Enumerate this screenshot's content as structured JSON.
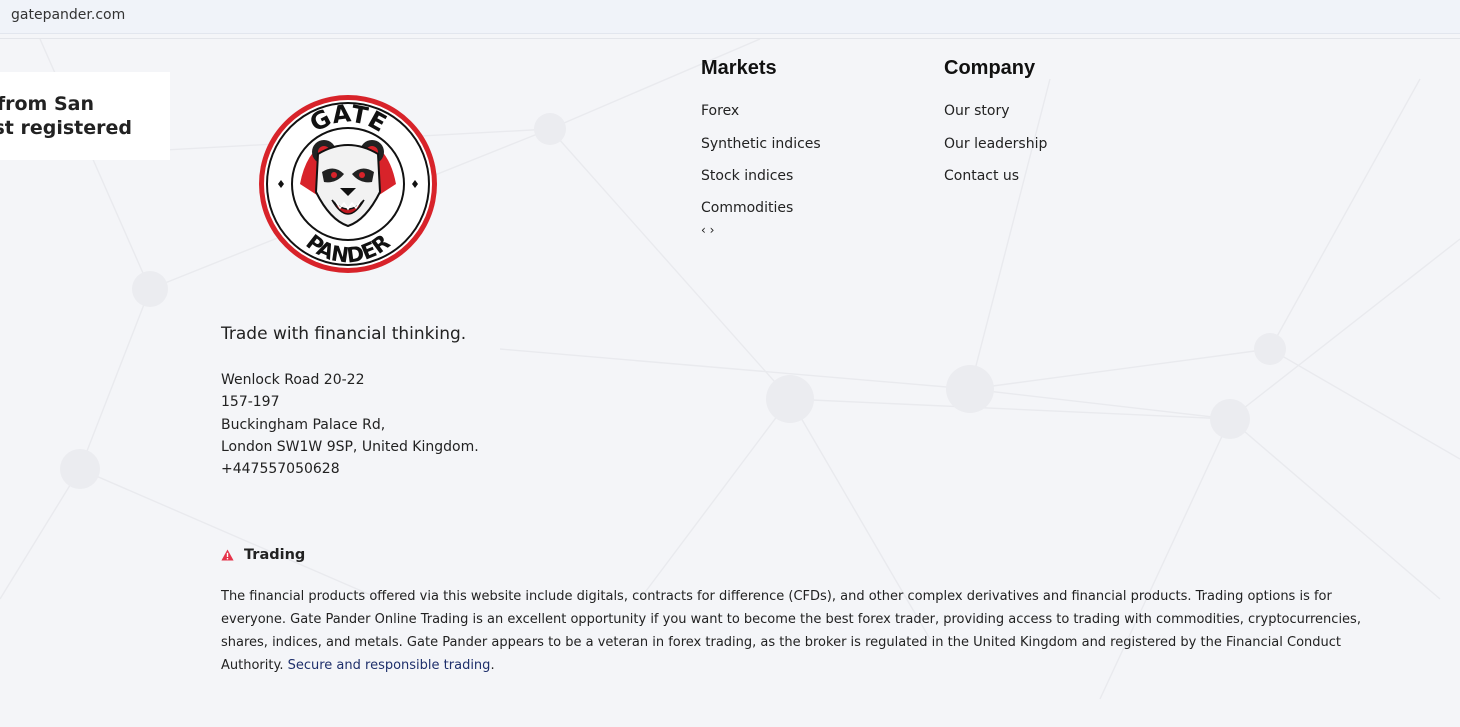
{
  "browser": {
    "url": "gatepander.com"
  },
  "notification": {
    "line1": "e from San",
    "line2": "ust registered"
  },
  "brand": {
    "logo_text_top": "GATE",
    "logo_text_bottom": "PANDER",
    "logo_icon": "panda-mascot-icon",
    "tagline": "Trade with financial thinking."
  },
  "address": {
    "line1": "Wenlock Road 20-22",
    "line2": "157-197",
    "line3": "Buckingham Palace Rd,",
    "line4": "London SW1W 9SP, United Kingdom.",
    "phone": "+447557050628"
  },
  "markets": {
    "title": "Markets",
    "items": [
      "Forex",
      "Synthetic indices",
      "Stock indices",
      "Commodities"
    ],
    "arrows": "‹ ›"
  },
  "company": {
    "title": "Company",
    "items": [
      "Our story",
      "Our leadership",
      "Contact us"
    ]
  },
  "trading": {
    "title": "Trading",
    "warning_icon": "warning-triangle-icon",
    "accent_color": "#e5334a",
    "disclaimer": "The financial products offered via this website include digitals, contracts for difference (CFDs), and other complex derivatives and financial products. Trading options is for everyone. Gate Pander Online Trading is an excellent opportunity if you want to become the best forex trader, providing access to trading with commodities, cryptocurrencies, shares, indices, and metals. Gate Pander appears to be a veteran in forex trading, as the broker is regulated in the United Kingdom and registered by the Financial Conduct Authority.",
    "link_text": "Secure and responsible trading",
    "link_suffix": "."
  },
  "colors": {
    "background": "#f4f5f8",
    "logo_red": "#d8232a",
    "link_blue": "#1e2f6b"
  }
}
